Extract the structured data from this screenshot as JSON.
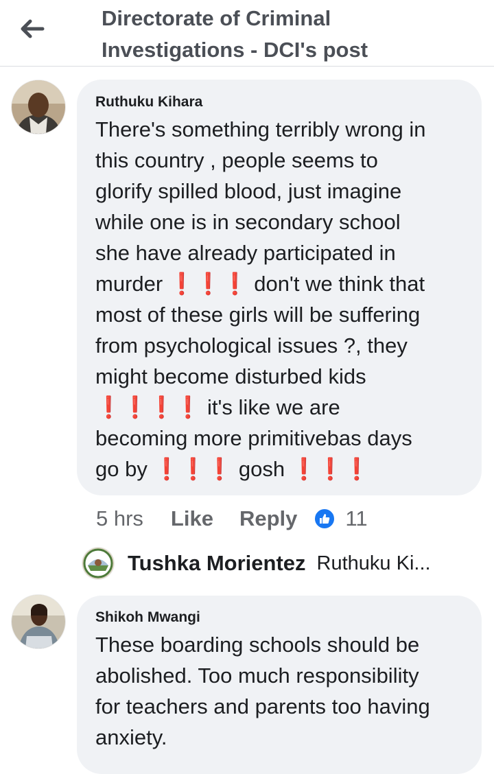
{
  "header": {
    "title_line1": "Directorate of Criminal",
    "title_line2": "Investigations - DCI's post"
  },
  "comments": [
    {
      "author": "Ruthuku Kihara",
      "text": "There's something terribly wrong in\nthis country , people seems to\nglorify spilled blood, just imagine\nwhile one is in secondary school\nshe  have already participated in\nmurder ❗❗❗ don't we think that\nmost of these girls will be suffering\nfrom psychological issues ?, they\nmight become disturbed kids\n❗❗❗❗ it's like we are\nbecoming more primitivebas days\ngo by ❗❗❗ gosh ❗❗❗",
      "time": "5 hrs",
      "like_label": "Like",
      "reply_label": "Reply",
      "reaction_count": "11",
      "reaction_icon": "thumbs-up-icon",
      "reply_preview": {
        "author": "Tushka Morientez",
        "snippet": "Ruthuku Ki..."
      }
    },
    {
      "author": "Shikoh Mwangi",
      "text": "These boarding schools should be\nabolished. Too much responsibility\nfor teachers and parents too having\nanxiety."
    }
  ],
  "colors": {
    "bubble": "#f0f2f5",
    "meta_text": "#65676b",
    "like_blue": "#1877f2",
    "exclamation_red": "#e0242f"
  }
}
